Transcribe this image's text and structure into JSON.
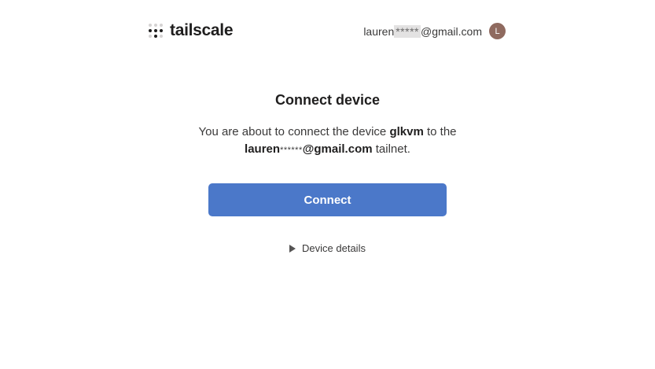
{
  "header": {
    "logo_text": "tailscale",
    "account": {
      "email_prefix": "lauren",
      "email_mask": "*****",
      "email_suffix": "@gmail.com",
      "avatar_initial": "L"
    }
  },
  "main": {
    "title": "Connect device",
    "description": {
      "part1": "You are about to connect the device ",
      "device_name": "glkvm",
      "part2": " to the",
      "tailnet_prefix": "lauren",
      "tailnet_mask": "******",
      "tailnet_suffix": "@gmail.com",
      "part3": " tailnet."
    },
    "connect_label": "Connect",
    "details_label": "Device details"
  },
  "colors": {
    "primary_button": "#4b78c9",
    "avatar": "#8f6a5f",
    "text": "#1f1e1e"
  },
  "icons": {
    "logo": "tailscale-dots-icon",
    "details_toggle": "triangle-right-icon"
  }
}
